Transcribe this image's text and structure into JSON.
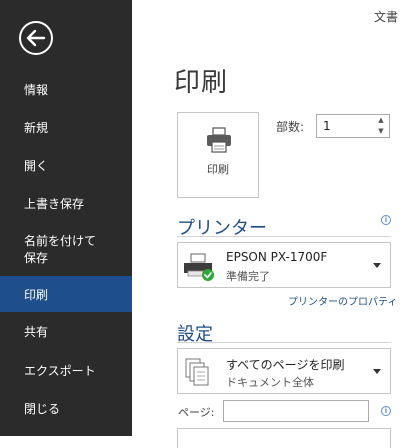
{
  "window": {
    "doc_title": "文書"
  },
  "sidebar": {
    "items": [
      {
        "label": "情報"
      },
      {
        "label": "新規"
      },
      {
        "label": "開く"
      },
      {
        "label": "上書き保存"
      },
      {
        "label": "名前を付けて\n保存"
      },
      {
        "label": "印刷",
        "active": true
      },
      {
        "label": "共有"
      },
      {
        "label": "エクスポート"
      },
      {
        "label": "閉じる"
      }
    ]
  },
  "main": {
    "title": "印刷",
    "print_button": {
      "label": "印刷"
    },
    "copies": {
      "label": "部数:",
      "value": "1"
    },
    "printer": {
      "heading": "プリンター",
      "name": "EPSON PX-1700F",
      "status": "準備完了",
      "properties_link": "プリンターのプロパティ"
    },
    "settings": {
      "heading": "設定",
      "scope_title": "すべてのページを印刷",
      "scope_sub": "ドキュメント全体",
      "pages_label": "ページ:",
      "pages_value": ""
    }
  },
  "colors": {
    "sidebar_bg": "#2b2b2b",
    "active_bg": "#1f4e8c",
    "accent": "#1f4e8c"
  },
  "icons": [
    "back-arrow-icon",
    "printer-icon",
    "info-icon",
    "chevron-down-icon",
    "pages-icon"
  ]
}
